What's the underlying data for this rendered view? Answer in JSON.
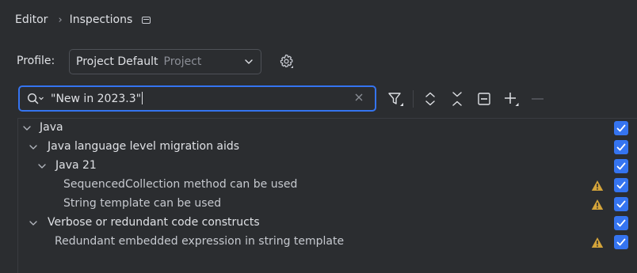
{
  "breadcrumb": {
    "parent": "Editor",
    "current": "Inspections"
  },
  "profile": {
    "label": "Profile:",
    "value": "Project Default",
    "scope": "Project"
  },
  "search": {
    "query": "\"New in 2023.3\""
  },
  "colors": {
    "accent": "#3574f0",
    "warning": "#d4a43a",
    "background": "#2b2d30"
  },
  "toolbar": {
    "icons": [
      "filter-icon",
      "expand-all-icon",
      "collapse-all-icon",
      "reset-icon",
      "add-icon",
      "remove-icon"
    ]
  },
  "tree": [
    {
      "label": "Java",
      "level": 0,
      "expandable": true,
      "checked": true,
      "warning": false
    },
    {
      "label": "Java language level migration aids",
      "level": 1,
      "expandable": true,
      "checked": true,
      "warning": false
    },
    {
      "label": "Java 21",
      "level": 2,
      "expandable": true,
      "checked": true,
      "warning": false
    },
    {
      "label": "SequencedCollection method can be used",
      "level": 3,
      "expandable": false,
      "checked": true,
      "warning": true
    },
    {
      "label": "String template can be used",
      "level": 3,
      "expandable": false,
      "checked": true,
      "warning": true
    },
    {
      "label": "Verbose or redundant code constructs",
      "level": 1,
      "expandable": true,
      "checked": true,
      "warning": false
    },
    {
      "label": "Redundant embedded expression in string template",
      "level": 2,
      "expandable": false,
      "checked": true,
      "warning": true
    }
  ]
}
